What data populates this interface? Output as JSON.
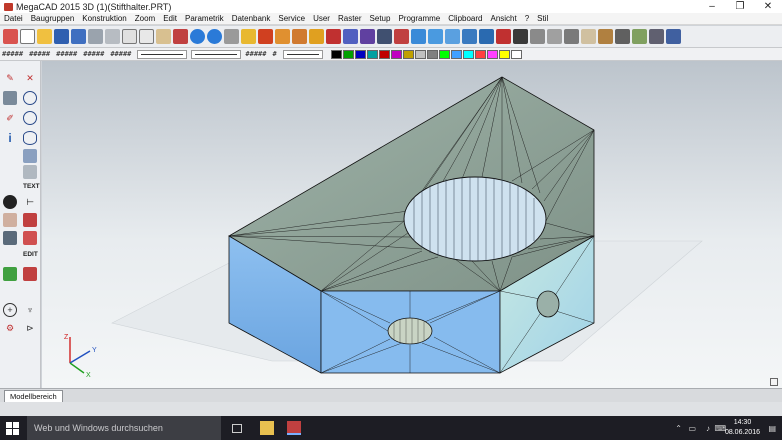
{
  "window": {
    "title": "MegaCAD 2015 3D (1)(Stifthalter.PRT)",
    "controls": [
      "–",
      "❐",
      "✕"
    ]
  },
  "menu": [
    "Datei",
    "Baugruppen",
    "Konstruktion",
    "Zoom",
    "Edit",
    "Parametrik",
    "Datenbank",
    "Service",
    "User",
    "Raster",
    "Setup",
    "Programme",
    "Clipboard",
    "Ansicht",
    "?",
    "Stil"
  ],
  "toolbar2": {
    "labels": [
      "#####",
      "#####",
      "#####",
      "#####",
      "#####",
      "#####",
      "#"
    ],
    "colors": [
      "#000000",
      "#00a000",
      "#0000c0",
      "#00a0a0",
      "#c00000",
      "#c000c0",
      "#c0a000",
      "#c0c0c0",
      "#808080",
      "#00ff00",
      "#40a0ff",
      "#00ffff",
      "#ff4040",
      "#ff40ff",
      "#ffff00",
      "#ffffff"
    ]
  },
  "leftbar": {
    "text_label": "TEXT",
    "edit_label": "EDIT"
  },
  "viewport": {
    "axes": {
      "x": "X",
      "y": "Y",
      "z": "Z"
    }
  },
  "tabs": {
    "model": "Modellbereich"
  },
  "taskbar": {
    "search_placeholder": "Web und Windows durchsuchen",
    "time": "14:30",
    "date": "08.06.2016"
  }
}
